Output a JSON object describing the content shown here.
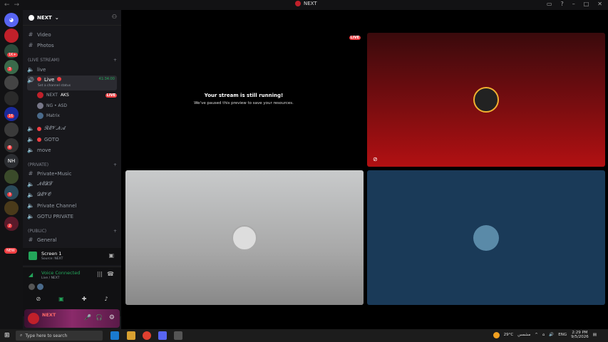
{
  "window": {
    "title": "NEXT"
  },
  "guild_badges": [
    "1K+",
    "3",
    "16",
    "8",
    "3",
    "2"
  ],
  "guild_labels": [
    "NH"
  ],
  "guild_new": "NEW",
  "server": {
    "name": "NEXT"
  },
  "channels_top": [
    {
      "name": "Video"
    },
    {
      "name": "Photos"
    }
  ],
  "categories": {
    "live": "(LIVE STREAM)",
    "private": "(PRIVATE)",
    "public": "(PUBLIC)"
  },
  "live_channels": {
    "first": "live",
    "active": {
      "name": "Live",
      "timer": "41:34:00",
      "status": "Set a channel status"
    },
    "members": [
      {
        "name": "NEXT",
        "extra": "AKS",
        "live": "LIVE"
      },
      {
        "name": "NG • ASD"
      },
      {
        "name": "Matrix"
      }
    ],
    "others": [
      "𝓡𝓔𝓥𝓝𝓐",
      "GOTO",
      "move"
    ]
  },
  "private_channels": [
    "Private•Music",
    "𝓝𝓔𝓧𝓣",
    "𝓓𝓔𝓥𝓞",
    "Private Channel",
    "GOTU PRIVATE"
  ],
  "public_channels": [
    "General"
  ],
  "screen_panel": {
    "title": "Screen 1",
    "sub": "Source: NEXT"
  },
  "voice": {
    "status": "Voice Connected",
    "channel": "Live / NEXT"
  },
  "user": {
    "name": "NEXT"
  },
  "stream": {
    "live_label": "LIVE",
    "paused_title": "Your stream is still running!",
    "paused_sub": "We've paused this preview to save your resources."
  },
  "taskbar": {
    "search_placeholder": "Type here to search",
    "weather": "29°C",
    "weather_text": "مشمس",
    "lang": "ENG",
    "time": "2:29 PM",
    "date": "9/5/2026"
  },
  "colors": {
    "brand": "#5865f2",
    "live": "#f23f43",
    "connected": "#23a55a",
    "tile_red": "#b21012",
    "tile_blue": "#1a3a58"
  }
}
